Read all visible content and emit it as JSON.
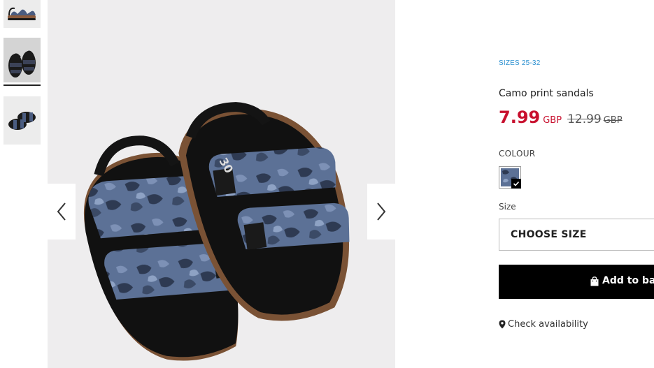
{
  "gallery": {
    "thumbnails": [
      {
        "name": "thumb-side-view"
      },
      {
        "name": "thumb-pair-view",
        "selected": true
      },
      {
        "name": "thumb-top-view"
      }
    ],
    "prev_icon": "chevron-left-icon",
    "next_icon": "chevron-right-icon",
    "insole_size_mark": "30"
  },
  "product": {
    "sizes_tag": "SIZES 25-32",
    "title": "Camo print sandals",
    "price": "7.99",
    "currency": "GBP",
    "old_price": "12.99",
    "old_currency": "GBP",
    "colour_label": "COLOUR",
    "size_label": "Size",
    "size_select_value": "CHOOSE SIZE",
    "add_to_bag_label": "Add to bag",
    "check_availability_label": "Check availability"
  },
  "colors": {
    "price_red": "#c8102e",
    "tag_blue": "#2a8fd0",
    "button_black": "#000000"
  }
}
